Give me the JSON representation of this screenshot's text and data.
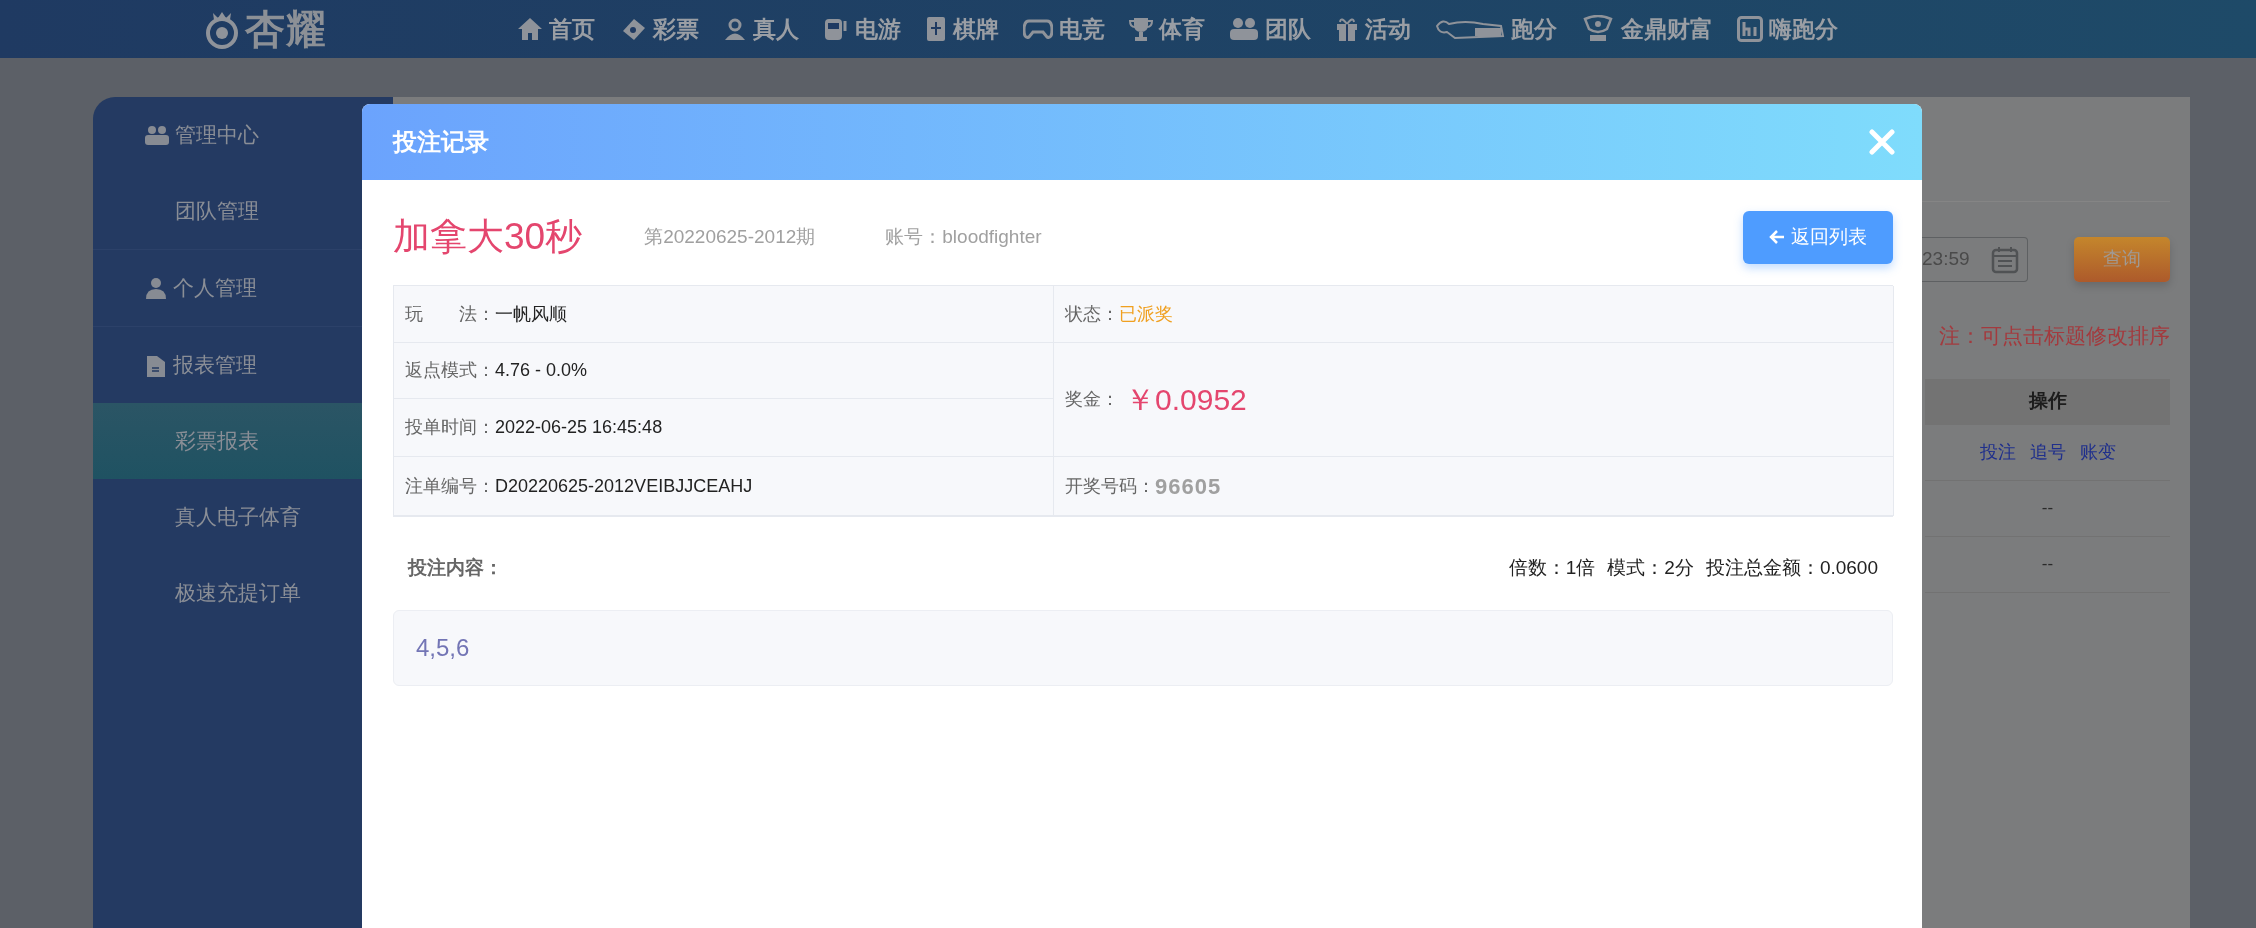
{
  "top_nav": {
    "logo": "杏耀",
    "items": [
      {
        "label": "首页"
      },
      {
        "label": "彩票"
      },
      {
        "label": "真人"
      },
      {
        "label": "电游"
      },
      {
        "label": "棋牌"
      },
      {
        "label": "电竞"
      },
      {
        "label": "体育"
      },
      {
        "label": "团队"
      },
      {
        "label": "活动"
      },
      {
        "label": "跑分"
      },
      {
        "label": "金鼎财富"
      },
      {
        "label": "嗨跑分"
      }
    ]
  },
  "sidebar": {
    "groups": [
      {
        "title": "管理中心",
        "children": [
          {
            "label": "团队管理",
            "selected": false
          }
        ]
      },
      {
        "title": "个人管理"
      },
      {
        "title": "报表管理",
        "children": [
          {
            "label": "彩票报表",
            "selected": true
          },
          {
            "label": "真人电子体育",
            "selected": false
          },
          {
            "label": "极速充提订单",
            "selected": false
          }
        ]
      }
    ]
  },
  "background_panel": {
    "date_value": "23:59",
    "query_button": "查询",
    "note": "注：可点击标题修改排序",
    "table": {
      "columns": [
        "操作"
      ],
      "rows": [
        {
          "links": [
            "投注",
            "追号",
            "账变"
          ]
        },
        {
          "text": "--"
        },
        {
          "text": "--"
        }
      ]
    }
  },
  "modal": {
    "title": "投注记录",
    "lottery": "加拿大30秒",
    "period": "第20220625-2012期",
    "account": "账号：bloodfighter",
    "back_button": "返回列表",
    "details": {
      "play": {
        "label": "玩　　法：",
        "value": "一帆风顺"
      },
      "rebate": {
        "label": "返点模式：",
        "value": "4.76 - 0.0%"
      },
      "bet_time": {
        "label": "投单时间：",
        "value": "2022-06-25 16:45:48"
      },
      "order_no": {
        "label": "注单编号：",
        "value": "D20220625-2012VEIBJJCEAHJ"
      },
      "status": {
        "label": "状态：",
        "value": "已派奖"
      },
      "prize": {
        "label": "奖金：",
        "value": "￥0.0952"
      },
      "draw_number": {
        "label": "开奖号码：",
        "value": "96605"
      }
    },
    "content_label": "投注内容：",
    "summary": [
      "倍数：1倍",
      "模式：2分",
      "投注总金额：0.0600"
    ],
    "numbers": "4,5,6"
  }
}
